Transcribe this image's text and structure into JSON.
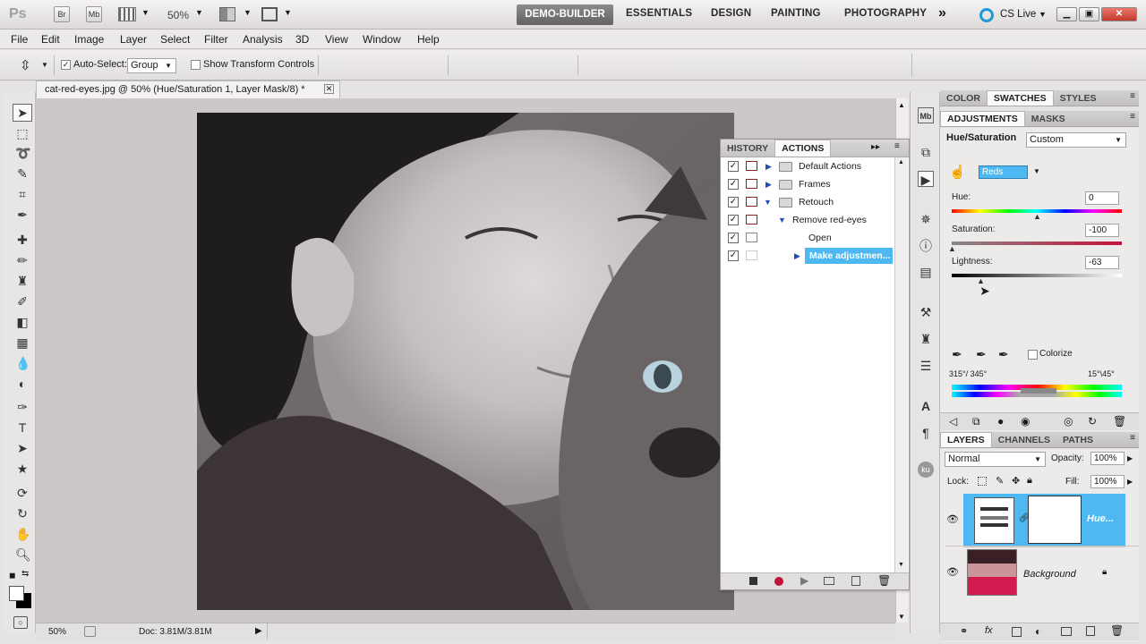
{
  "app": {
    "logo": "Ps",
    "bridge": "Br",
    "minibridge": "Mb",
    "zoom": "50%",
    "workspaces": [
      "ESSENTIALS",
      "DESIGN",
      "PAINTING",
      "PHOTOGRAPHY"
    ],
    "active_workspace": "DEMO-BUILDER",
    "more": "»",
    "cs_live": "CS Live"
  },
  "menu": [
    "File",
    "Edit",
    "Image",
    "Layer",
    "Select",
    "Filter",
    "Analysis",
    "3D",
    "View",
    "Window",
    "Help"
  ],
  "options": {
    "auto_select_label": "Auto-Select:",
    "auto_select_value": "Group",
    "transform_controls_label": "Show Transform Controls"
  },
  "document": {
    "tab_title": "cat-red-eyes.jpg @ 50% (Hue/Saturation 1, Layer Mask/8) *",
    "status_zoom": "50%",
    "status_doc": "Doc: 3.81M/3.81M"
  },
  "actions_panel": {
    "tabs": [
      "HISTORY",
      "ACTIONS"
    ],
    "active_tab": "ACTIONS",
    "rows": [
      {
        "label": "Default Actions",
        "level": 1,
        "type": "set",
        "expanded": false,
        "dialog": true
      },
      {
        "label": "Frames",
        "level": 1,
        "type": "set",
        "expanded": false,
        "dialog": true
      },
      {
        "label": "Retouch",
        "level": 1,
        "type": "set",
        "expanded": true,
        "dialog": true
      },
      {
        "label": "Remove red-eyes",
        "level": 2,
        "type": "action",
        "expanded": true,
        "dialog": true
      },
      {
        "label": "Open",
        "level": 3,
        "type": "step",
        "expanded": false,
        "dialog": false
      },
      {
        "label": "Make adjustmen...",
        "level": 3,
        "type": "step",
        "expanded": false,
        "dialog": false,
        "selected": true
      }
    ]
  },
  "color_panel": {
    "tabs": [
      "COLOR",
      "SWATCHES",
      "STYLES"
    ],
    "active_tab": "SWATCHES"
  },
  "adjustments_panel": {
    "tabs": [
      "ADJUSTMENTS",
      "MASKS"
    ],
    "active_tab": "ADJUSTMENTS",
    "title": "Hue/Saturation",
    "preset": "Custom",
    "channel": "Reds",
    "hue_label": "Hue:",
    "hue_value": "0",
    "saturation_label": "Saturation:",
    "saturation_value": "-100",
    "lightness_label": "Lightness:",
    "lightness_value": "-63",
    "colorize_label": "Colorize",
    "range_left": "315°/ 345°",
    "range_right": "15°\\45°"
  },
  "layers_panel": {
    "tabs": [
      "LAYERS",
      "CHANNELS",
      "PATHS"
    ],
    "active_tab": "LAYERS",
    "blend_mode": "Normal",
    "opacity_label": "Opacity:",
    "opacity_value": "100%",
    "lock_label": "Lock:",
    "fill_label": "Fill:",
    "fill_value": "100%",
    "layers": [
      {
        "name": "Hue...",
        "selected": true
      },
      {
        "name": "Background",
        "selected": false
      }
    ]
  }
}
